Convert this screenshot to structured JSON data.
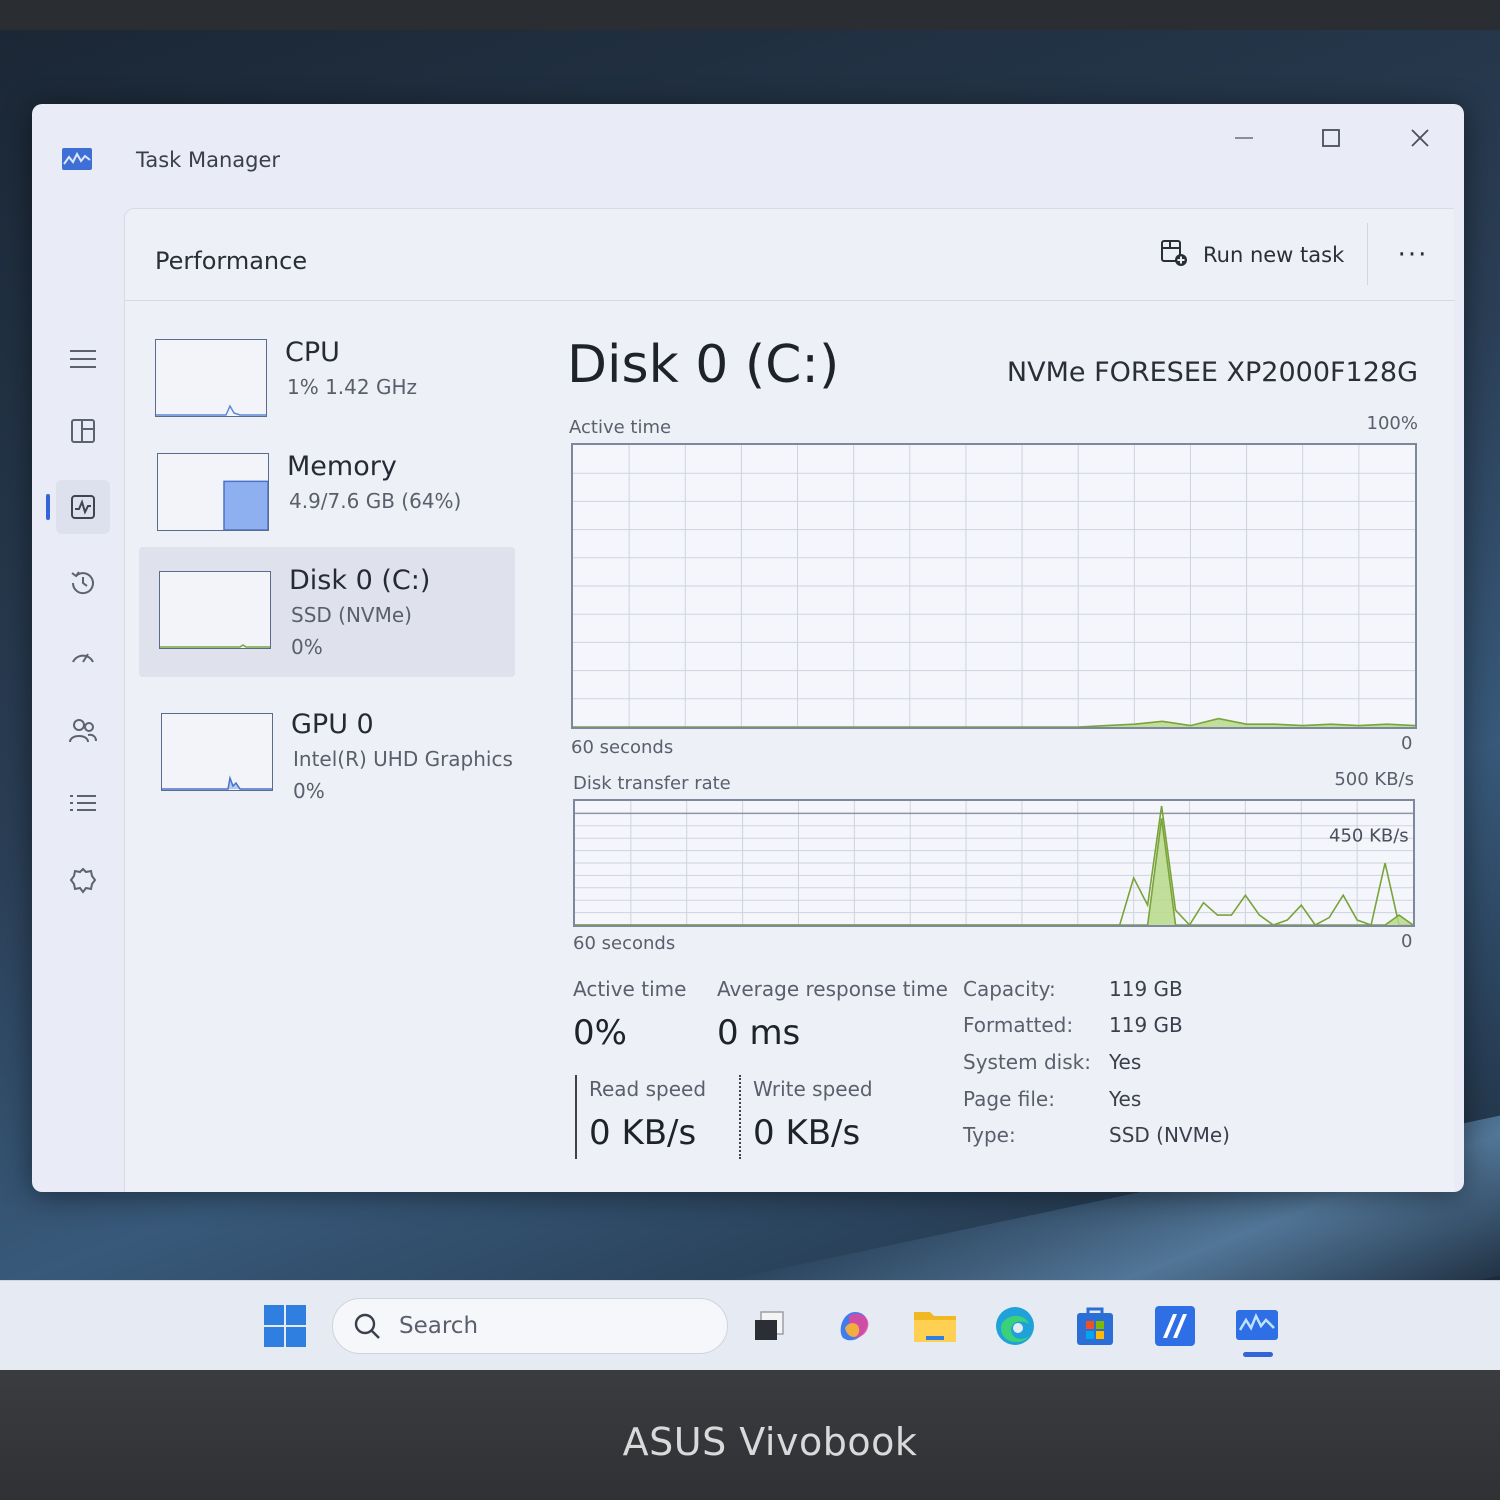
{
  "window": {
    "title": "Task Manager",
    "controls": {
      "minimize": "—",
      "maximize": "☐",
      "close": "✕"
    }
  },
  "header": {
    "title": "Performance",
    "run_new_task": "Run new task",
    "more": "···"
  },
  "rail": {
    "items": [
      "hamburger-menu-icon",
      "processes-icon",
      "performance-icon",
      "app-history-icon",
      "startup-apps-icon",
      "users-icon",
      "details-icon",
      "services-icon",
      "settings-icon"
    ],
    "active": "performance-icon"
  },
  "resources": [
    {
      "name": "CPU",
      "sub": "1%  1.42 GHz",
      "sub2": ""
    },
    {
      "name": "Memory",
      "sub": "4.9/7.6 GB (64%)",
      "sub2": ""
    },
    {
      "name": "Disk 0 (C:)",
      "sub": "SSD (NVMe)",
      "sub2": "0%"
    },
    {
      "name": "GPU 0",
      "sub": "Intel(R) UHD Graphics",
      "sub2": "0%"
    }
  ],
  "memory_usage_fraction": 0.64,
  "detail": {
    "title": "Disk 0 (C:)",
    "model": "NVMe FORESEE XP2000F128G",
    "active_chart": {
      "label": "Active time",
      "max_label": "100%",
      "x_label": "60 seconds",
      "zero_label": "0"
    },
    "transfer_chart": {
      "label": "Disk transfer rate",
      "max_label": "500 KB/s",
      "line_label": "450 KB/s",
      "x_label": "60 seconds",
      "zero_label": "0"
    },
    "stats": {
      "active_time_label": "Active time",
      "active_time_value": "0%",
      "avg_response_label": "Average response time",
      "avg_response_value": "0 ms",
      "read_label": "Read speed",
      "read_value": "0 KB/s",
      "write_label": "Write speed",
      "write_value": "0 KB/s"
    },
    "properties": [
      {
        "key": "Capacity:",
        "value": "119 GB"
      },
      {
        "key": "Formatted:",
        "value": "119 GB"
      },
      {
        "key": "System disk:",
        "value": "Yes"
      },
      {
        "key": "Page file:",
        "value": "Yes"
      },
      {
        "key": "Type:",
        "value": "SSD (NVMe)"
      }
    ]
  },
  "taskbar": {
    "search_placeholder": "Search",
    "icons": [
      "windows-start-icon",
      "task-view-icon",
      "copilot-icon",
      "file-explorer-icon",
      "edge-icon",
      "store-icon",
      "myasus-icon",
      "task-manager-icon"
    ]
  },
  "laptop_brand": "ASUS Vivobook",
  "colors": {
    "accent": "#3465d8",
    "disk_line": "#7aa33a",
    "disk_fill": "#b8d98a",
    "memory_fill": "#8fb0f0"
  },
  "chart_data": [
    {
      "type": "area",
      "title": "Active time",
      "xlabel": "60 seconds",
      "ylabel": "Active time",
      "ylim": [
        0,
        100
      ],
      "x": [
        0,
        2,
        4,
        6,
        8,
        10,
        12,
        14,
        16,
        18,
        20,
        22,
        24,
        26,
        28,
        30,
        32,
        34,
        36,
        38,
        40,
        42,
        44,
        46,
        48,
        50,
        52,
        54,
        56,
        58,
        60
      ],
      "series": [
        {
          "values": [
            0,
            0,
            0,
            0,
            0,
            0,
            0,
            0,
            0,
            0,
            0,
            0,
            0,
            0,
            0,
            0,
            0,
            0,
            0,
            0.5,
            1,
            2,
            0.5,
            3,
            1,
            1,
            0.5,
            1,
            0.5,
            1,
            0.5
          ]
        }
      ]
    },
    {
      "type": "area",
      "title": "Disk transfer rate",
      "xlabel": "60 seconds",
      "ylabel": "KB/s",
      "ylim": [
        0,
        500
      ],
      "reference_line": 450,
      "x": [
        0,
        2,
        4,
        6,
        8,
        10,
        12,
        14,
        16,
        18,
        20,
        22,
        24,
        26,
        28,
        30,
        32,
        34,
        36,
        38,
        39,
        40,
        41,
        42,
        43,
        44,
        45,
        46,
        47,
        48,
        49,
        50,
        51,
        52,
        53,
        54,
        55,
        56,
        57,
        58,
        59,
        60
      ],
      "series": [
        {
          "name": "Read speed",
          "values": [
            0,
            0,
            0,
            0,
            0,
            0,
            0,
            0,
            0,
            0,
            0,
            0,
            0,
            0,
            0,
            0,
            0,
            0,
            0,
            0,
            0,
            190,
            80,
            480,
            60,
            0,
            90,
            40,
            40,
            120,
            40,
            0,
            20,
            80,
            0,
            30,
            120,
            20,
            0,
            250,
            0,
            0
          ]
        },
        {
          "name": "Write speed",
          "values": [
            0,
            0,
            0,
            0,
            0,
            0,
            0,
            0,
            0,
            0,
            0,
            0,
            0,
            0,
            0,
            0,
            0,
            0,
            0,
            0,
            0,
            0,
            0,
            430,
            0,
            0,
            0,
            0,
            0,
            0,
            0,
            0,
            0,
            0,
            0,
            0,
            0,
            0,
            0,
            0,
            40,
            0
          ]
        }
      ]
    }
  ]
}
